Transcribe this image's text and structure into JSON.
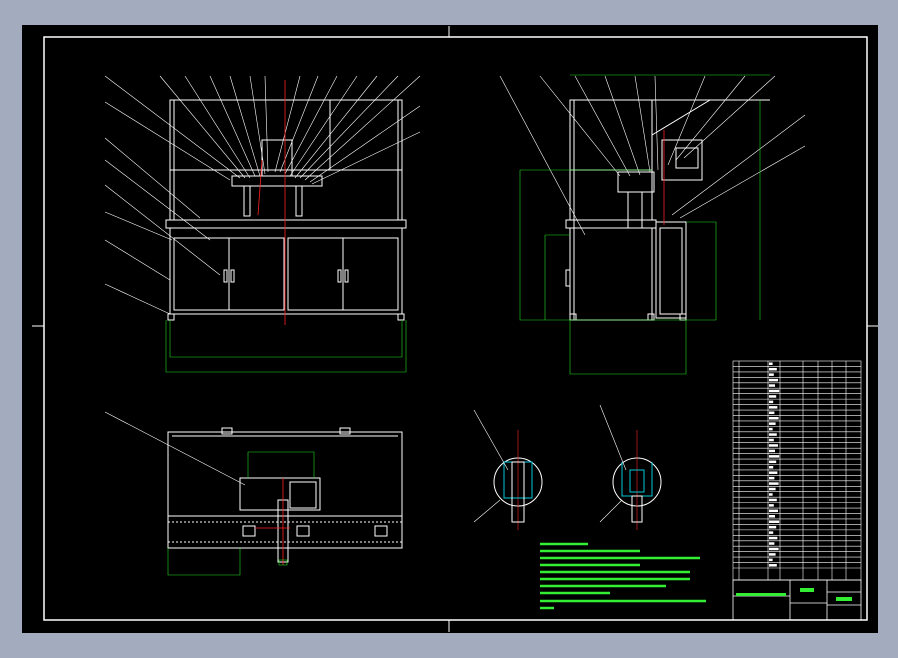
{
  "drawing": {
    "type": "CAD assembly drawing",
    "colors": {
      "background": "#000000",
      "frame": "#ffffff",
      "outline": "#ffffff",
      "centerline": "#ff2020",
      "dimension": "#22dd22",
      "hatch_detail": "#00c8d8",
      "annotation_text": "#33ee33",
      "outer_area": "#a3acbf"
    },
    "views": [
      "front-view",
      "side-view",
      "top-view",
      "detail-a",
      "detail-b",
      "bill-of-materials",
      "technical-requirements"
    ],
    "bom_rows": 38,
    "tech_notes_lines": 10
  }
}
